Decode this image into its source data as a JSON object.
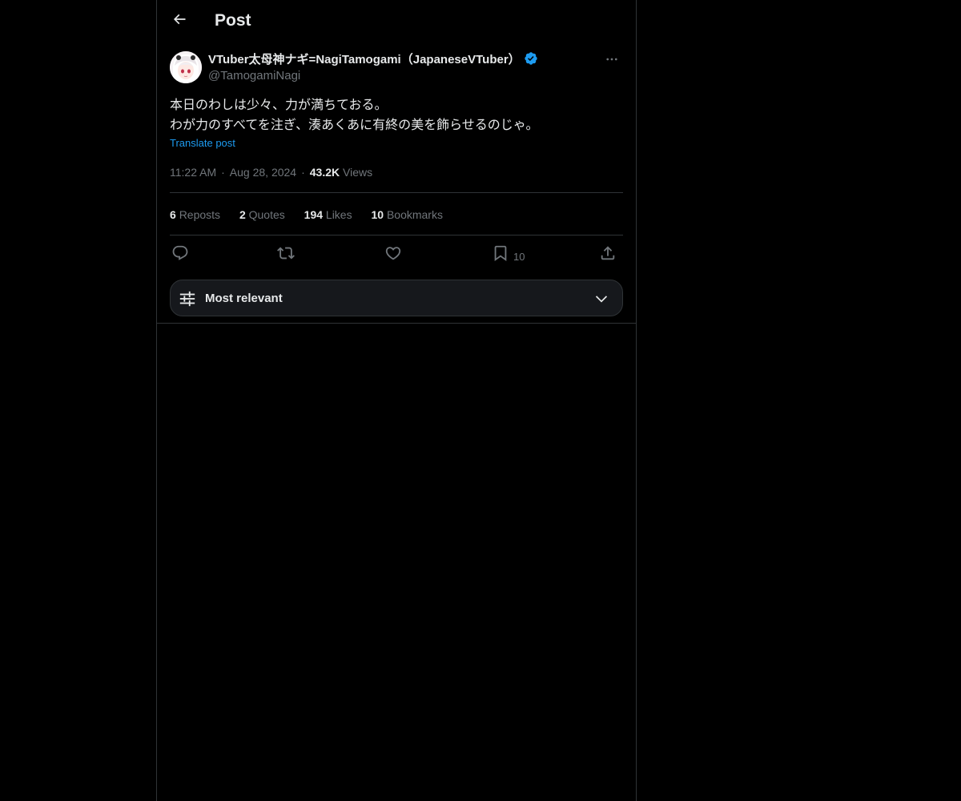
{
  "header": {
    "title": "Post",
    "back_icon": "arrow-left-icon"
  },
  "author": {
    "display_name": "VTuber太母神ナギ=NagiTamogami（JapaneseVTuber）",
    "handle": "@TamogamiNagi",
    "verified": true,
    "verified_color": "#1d9bf0",
    "avatar_icon": "avatar-image",
    "more_icon": "more-horizontal-icon"
  },
  "post": {
    "line1": "本日のわしは少々、力が満ちておる。",
    "line2": "わが力のすべてを注ぎ、湊あくあに有終の美を飾らせるのじゃ。",
    "translate_label": "Translate post"
  },
  "meta": {
    "time": "11:22 AM",
    "separator": "·",
    "date": "Aug 28, 2024",
    "views_count": "43.2K",
    "views_label": "Views"
  },
  "stats": {
    "reposts": {
      "count": "6",
      "label": "Reposts"
    },
    "quotes": {
      "count": "2",
      "label": "Quotes"
    },
    "likes": {
      "count": "194",
      "label": "Likes"
    },
    "bookmarks": {
      "count": "10",
      "label": "Bookmarks"
    }
  },
  "actions": {
    "reply": {
      "icon": "reply-icon"
    },
    "repost": {
      "icon": "repost-icon"
    },
    "like": {
      "icon": "heart-icon"
    },
    "bookmark": {
      "icon": "bookmark-icon",
      "count": "10"
    },
    "share": {
      "icon": "share-icon"
    }
  },
  "sort": {
    "label": "Most relevant",
    "icon": "sliders-icon",
    "chevron": "chevron-down-icon"
  },
  "colors": {
    "background": "#000000",
    "text_primary": "#e7e9ea",
    "text_secondary": "#71767b",
    "accent": "#1d9bf0",
    "border": "#2f3336"
  }
}
